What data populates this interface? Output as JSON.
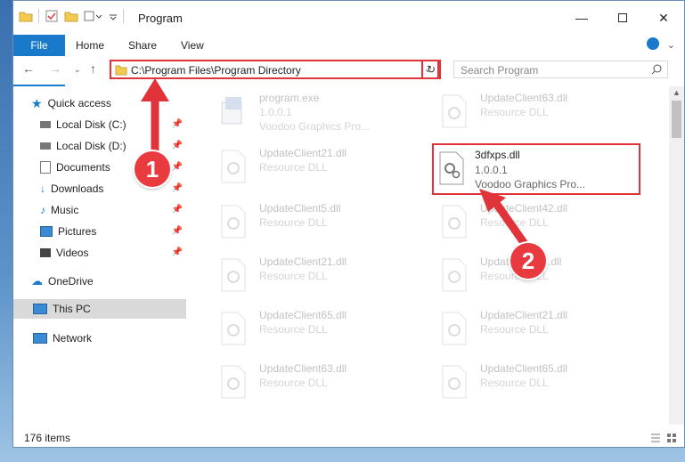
{
  "window": {
    "title": "Program"
  },
  "ribbon": {
    "tabs": [
      {
        "label": "File"
      },
      {
        "label": "Home"
      },
      {
        "label": "Share"
      },
      {
        "label": "View"
      }
    ]
  },
  "address": {
    "path": "C:\\Program Files\\Program Directory"
  },
  "search": {
    "placeholder": "Search Program"
  },
  "nav": {
    "items": [
      {
        "label": "Quick access"
      },
      {
        "label": "Local Disk (C:)"
      },
      {
        "label": "Local Disk (D:)"
      },
      {
        "label": "Documents"
      },
      {
        "label": "Downloads"
      },
      {
        "label": "Music"
      },
      {
        "label": "Pictures"
      },
      {
        "label": "Videos"
      },
      {
        "label": "OneDrive"
      },
      {
        "label": "This PC"
      },
      {
        "label": "Network"
      }
    ]
  },
  "files": [
    {
      "name": "program.exe",
      "line1": "1.0.0.1",
      "line2": "Voodoo Graphics Pro..."
    },
    {
      "name": "UpdateClient63.dll",
      "line1": "Resource DLL"
    },
    {
      "name": "UpdateClient21.dll",
      "line1": "Resource DLL"
    },
    {
      "name": "3dfxps.dll",
      "line1": "1.0.0.1",
      "line2": "Voodoo Graphics Pro..."
    },
    {
      "name": "UpdateClient5.dll",
      "line1": "Resource DLL"
    },
    {
      "name": "UpdateClient42.dll",
      "line1": "Resource DLL"
    },
    {
      "name": "UpdateClient21.dll",
      "line1": "Resource DLL"
    },
    {
      "name": "UpdateClient9.dll",
      "line1": "Resource DLL"
    },
    {
      "name": "UpdateClient65.dll",
      "line1": "Resource DLL"
    },
    {
      "name": "UpdateClient21.dll",
      "line1": "Resource DLL"
    },
    {
      "name": "UpdateClient63.dll",
      "line1": "Resource DLL"
    },
    {
      "name": "UpdateClient65.dll",
      "line1": "Resource DLL"
    }
  ],
  "status": {
    "items": "176 items"
  },
  "annotations": {
    "one": "1",
    "two": "2"
  },
  "colors": {
    "accent": "#1979ca",
    "highlight": "#e0333a"
  }
}
